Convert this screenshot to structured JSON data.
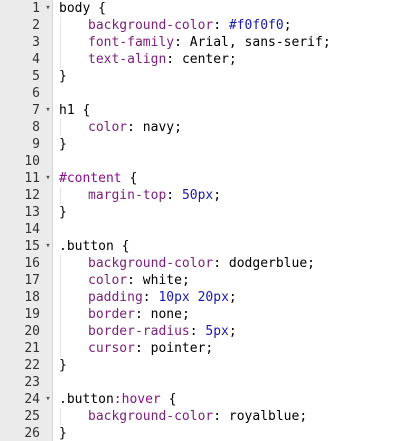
{
  "lines": [
    {
      "n": "1",
      "fold": true,
      "indent": false,
      "tokens": [
        {
          "t": "body",
          "c": "sel"
        },
        {
          "t": " {",
          "c": "punc"
        }
      ]
    },
    {
      "n": "2",
      "fold": false,
      "indent": true,
      "tokens": [
        {
          "t": "background-color",
          "c": "prop"
        },
        {
          "t": ": ",
          "c": "punc"
        },
        {
          "t": "#f0f0f0",
          "c": "num"
        },
        {
          "t": ";",
          "c": "punc"
        }
      ]
    },
    {
      "n": "3",
      "fold": false,
      "indent": true,
      "tokens": [
        {
          "t": "font-family",
          "c": "prop"
        },
        {
          "t": ": ",
          "c": "punc"
        },
        {
          "t": "Arial, sans-serif",
          "c": "val"
        },
        {
          "t": ";",
          "c": "punc"
        }
      ]
    },
    {
      "n": "4",
      "fold": false,
      "indent": true,
      "tokens": [
        {
          "t": "text-align",
          "c": "prop"
        },
        {
          "t": ": ",
          "c": "punc"
        },
        {
          "t": "center",
          "c": "val"
        },
        {
          "t": ";",
          "c": "punc"
        }
      ]
    },
    {
      "n": "5",
      "fold": false,
      "indent": false,
      "tokens": [
        {
          "t": "}",
          "c": "punc"
        }
      ]
    },
    {
      "n": "6",
      "fold": false,
      "indent": false,
      "tokens": []
    },
    {
      "n": "7",
      "fold": true,
      "indent": false,
      "tokens": [
        {
          "t": "h1",
          "c": "sel"
        },
        {
          "t": " {",
          "c": "punc"
        }
      ]
    },
    {
      "n": "8",
      "fold": false,
      "indent": true,
      "tokens": [
        {
          "t": "color",
          "c": "prop"
        },
        {
          "t": ": ",
          "c": "punc"
        },
        {
          "t": "navy",
          "c": "val"
        },
        {
          "t": ";",
          "c": "punc"
        }
      ]
    },
    {
      "n": "9",
      "fold": false,
      "indent": false,
      "tokens": [
        {
          "t": "}",
          "c": "punc"
        }
      ]
    },
    {
      "n": "10",
      "fold": false,
      "indent": false,
      "tokens": []
    },
    {
      "n": "11",
      "fold": true,
      "indent": false,
      "tokens": [
        {
          "t": "#content",
          "c": "id"
        },
        {
          "t": " {",
          "c": "punc"
        }
      ]
    },
    {
      "n": "12",
      "fold": false,
      "indent": true,
      "tokens": [
        {
          "t": "margin-top",
          "c": "prop"
        },
        {
          "t": ": ",
          "c": "punc"
        },
        {
          "t": "50px",
          "c": "num"
        },
        {
          "t": ";",
          "c": "punc"
        }
      ]
    },
    {
      "n": "13",
      "fold": false,
      "indent": false,
      "tokens": [
        {
          "t": "}",
          "c": "punc"
        }
      ]
    },
    {
      "n": "14",
      "fold": false,
      "indent": false,
      "tokens": []
    },
    {
      "n": "15",
      "fold": true,
      "indent": false,
      "tokens": [
        {
          "t": ".button",
          "c": "sel"
        },
        {
          "t": " {",
          "c": "punc"
        }
      ]
    },
    {
      "n": "16",
      "fold": false,
      "indent": true,
      "tokens": [
        {
          "t": "background-color",
          "c": "prop"
        },
        {
          "t": ": ",
          "c": "punc"
        },
        {
          "t": "dodgerblue",
          "c": "val"
        },
        {
          "t": ";",
          "c": "punc"
        }
      ]
    },
    {
      "n": "17",
      "fold": false,
      "indent": true,
      "tokens": [
        {
          "t": "color",
          "c": "prop"
        },
        {
          "t": ": ",
          "c": "punc"
        },
        {
          "t": "white",
          "c": "val"
        },
        {
          "t": ";",
          "c": "punc"
        }
      ]
    },
    {
      "n": "18",
      "fold": false,
      "indent": true,
      "tokens": [
        {
          "t": "padding",
          "c": "prop"
        },
        {
          "t": ": ",
          "c": "punc"
        },
        {
          "t": "10px",
          "c": "num"
        },
        {
          "t": " ",
          "c": "punc"
        },
        {
          "t": "20px",
          "c": "num"
        },
        {
          "t": ";",
          "c": "punc"
        }
      ]
    },
    {
      "n": "19",
      "fold": false,
      "indent": true,
      "tokens": [
        {
          "t": "border",
          "c": "prop"
        },
        {
          "t": ": ",
          "c": "punc"
        },
        {
          "t": "none",
          "c": "val"
        },
        {
          "t": ";",
          "c": "punc"
        }
      ]
    },
    {
      "n": "20",
      "fold": false,
      "indent": true,
      "tokens": [
        {
          "t": "border-radius",
          "c": "prop"
        },
        {
          "t": ": ",
          "c": "punc"
        },
        {
          "t": "5px",
          "c": "num"
        },
        {
          "t": ";",
          "c": "punc"
        }
      ]
    },
    {
      "n": "21",
      "fold": false,
      "indent": true,
      "tokens": [
        {
          "t": "cursor",
          "c": "prop"
        },
        {
          "t": ": ",
          "c": "punc"
        },
        {
          "t": "pointer",
          "c": "val"
        },
        {
          "t": ";",
          "c": "punc"
        }
      ]
    },
    {
      "n": "22",
      "fold": false,
      "indent": false,
      "tokens": [
        {
          "t": "}",
          "c": "punc"
        }
      ]
    },
    {
      "n": "23",
      "fold": false,
      "indent": false,
      "tokens": []
    },
    {
      "n": "24",
      "fold": true,
      "indent": false,
      "tokens": [
        {
          "t": ".button",
          "c": "sel"
        },
        {
          "t": ":hover",
          "c": "pseudo"
        },
        {
          "t": " {",
          "c": "punc"
        }
      ]
    },
    {
      "n": "25",
      "fold": false,
      "indent": true,
      "tokens": [
        {
          "t": "background-color",
          "c": "prop"
        },
        {
          "t": ": ",
          "c": "punc"
        },
        {
          "t": "royalblue",
          "c": "val"
        },
        {
          "t": ";",
          "c": "punc"
        }
      ]
    },
    {
      "n": "26",
      "fold": false,
      "indent": false,
      "tokens": [
        {
          "t": "}",
          "c": "punc"
        }
      ]
    }
  ],
  "fold_icon": "fold-arrow-down-icon",
  "colors": {
    "gutter_bg": "#ebebeb",
    "property": "#7a1f7a",
    "number": "#1a1aa6",
    "id_selector": "#8a0f8a"
  }
}
